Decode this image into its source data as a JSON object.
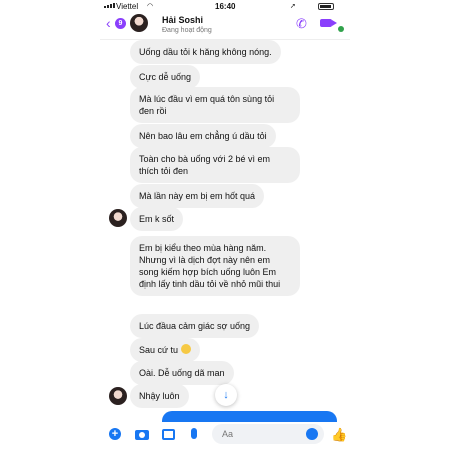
{
  "status_bar": {
    "carrier": "Viettel",
    "time": "16:40"
  },
  "header": {
    "badge_count": "9",
    "contact_name": "Hải Soshi",
    "contact_status": "Đang hoạt động"
  },
  "messages": [
    {
      "text": "Uống dầu tỏi k hăng không nóng."
    },
    {
      "text": "Cực dễ uống"
    },
    {
      "text": "Mà lúc đầu vì em quá tôn sùng tỏi đen rồi"
    },
    {
      "text": "Nên bao lâu em chẳng ú dầu tỏi"
    },
    {
      "text": "Toàn cho bà uống với 2 bé vì em thích tỏi đen"
    },
    {
      "text": "Mà lần này em bị em hốt quá"
    },
    {
      "text": "Em k sốt"
    },
    {
      "text": "Em bị kiểu theo mùa hàng năm. Nhưng vì là dịch đợt này nên em song kiếm hợp bích uống luôn Em định lấy tinh dầu tỏi về nhỏ mũi thui"
    },
    {
      "text": "Lúc đầua cảm giác sợ uống"
    },
    {
      "text": "Sau cứ tu"
    },
    {
      "text": "Oài. Dễ uống dã man"
    },
    {
      "text": "Nhậy luôn"
    }
  ],
  "composer": {
    "placeholder": "Aa"
  }
}
